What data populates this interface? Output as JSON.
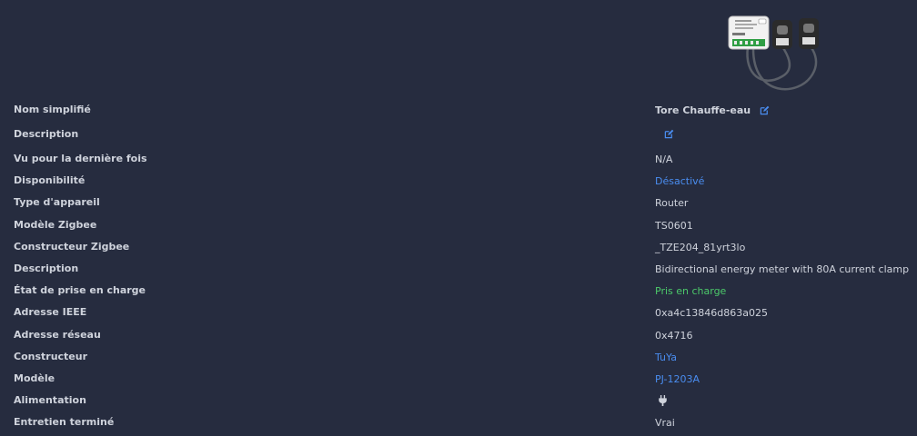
{
  "colors": {
    "background": "#262c3f",
    "text": "#cfd3dc",
    "link": "#4a8df0",
    "success": "#4cc96a"
  },
  "device": {
    "image_icon": "device-image"
  },
  "rows": [
    {
      "label": "Nom simplifié",
      "value": "Tore Chauffe-eau",
      "icon": "edit-icon"
    },
    {
      "label": "Description",
      "value": "",
      "icon": "edit-icon"
    },
    {
      "label": "Vu pour la dernière fois",
      "value": "N/A"
    },
    {
      "label": "Disponibilité",
      "value": "Désactivé"
    },
    {
      "label": "Type d'appareil",
      "value": "Router"
    },
    {
      "label": "Modèle Zigbee",
      "value": "TS0601"
    },
    {
      "label": "Constructeur Zigbee",
      "value": "_TZE204_81yrt3lo"
    },
    {
      "label": "Description",
      "value": "Bidirectional energy meter with 80A current clamp"
    },
    {
      "label": "État de prise en charge",
      "value": "Pris en charge"
    },
    {
      "label": "Adresse IEEE",
      "value": "0xa4c13846d863a025"
    },
    {
      "label": "Adresse réseau",
      "value": "0x4716"
    },
    {
      "label": "Constructeur",
      "value": "TuYa"
    },
    {
      "label": "Modèle",
      "value": "PJ-1203A"
    },
    {
      "label": "Alimentation",
      "value": "",
      "icon": "plug-icon"
    },
    {
      "label": "Entretien terminé",
      "value": "Vrai"
    }
  ]
}
